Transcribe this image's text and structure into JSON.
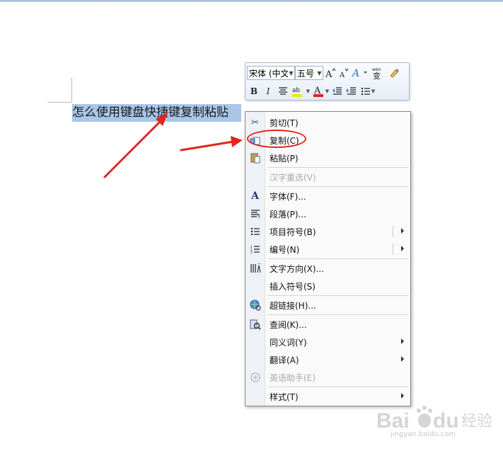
{
  "document": {
    "selected_text": "怎么使用键盘快捷键复制粘贴"
  },
  "mini_toolbar": {
    "font_name": "宋体 (中文",
    "font_size": "五号",
    "grow_font_icon": "grow-font-icon",
    "shrink_font_icon": "shrink-font-icon",
    "styles_icon": "styles-icon",
    "phonetic_guide_label": "wén",
    "phonetic_guide_char": "变",
    "bold_label": "B",
    "italic_label": "I",
    "font_color_label": "A",
    "highlight_label": "ab",
    "highlight_color": "#f5e300",
    "font_color": "#e0261e"
  },
  "context_menu": {
    "items": [
      {
        "icon": "scissors-icon",
        "label": "剪切(T)",
        "enabled": true,
        "submenu": false
      },
      {
        "icon": "copy-icon",
        "label": "复制(C)",
        "enabled": true,
        "submenu": false
      },
      {
        "icon": "paste-icon",
        "label": "粘贴(P)",
        "enabled": true,
        "submenu": false
      },
      {
        "icon": "reconvert-icon",
        "label": "汉字重选(V)",
        "enabled": false,
        "submenu": false
      },
      {
        "icon": "font-icon",
        "label": "字体(F)...",
        "enabled": true,
        "submenu": false
      },
      {
        "icon": "paragraph-icon",
        "label": "段落(P)...",
        "enabled": true,
        "submenu": false
      },
      {
        "icon": "bullets-icon",
        "label": "项目符号(B)",
        "enabled": true,
        "submenu": true
      },
      {
        "icon": "numbering-icon",
        "label": "编号(N)",
        "enabled": true,
        "submenu": true
      },
      {
        "icon": "text-direction-icon",
        "label": "文字方向(X)...",
        "enabled": true,
        "submenu": false
      },
      {
        "icon": "",
        "label": "插入符号(S)",
        "enabled": true,
        "submenu": false
      },
      {
        "icon": "hyperlink-icon",
        "label": "超链接(H)...",
        "enabled": true,
        "submenu": false
      },
      {
        "icon": "research-icon",
        "label": "查阅(K)...",
        "enabled": true,
        "submenu": false
      },
      {
        "icon": "",
        "label": "同义词(Y)",
        "enabled": true,
        "submenu": true
      },
      {
        "icon": "",
        "label": "翻译(A)",
        "enabled": true,
        "submenu": true
      },
      {
        "icon": "english-assistant-icon",
        "label": "英语助手(E)",
        "enabled": false,
        "submenu": false
      },
      {
        "icon": "",
        "label": "样式(T)",
        "enabled": true,
        "submenu": true
      }
    ]
  },
  "annotation": {
    "highlight_color": "#e0261e"
  },
  "watermark": {
    "brand": "Bai",
    "brand2": "du",
    "suffix": "经验",
    "site": "jingyan.baidu.com"
  }
}
